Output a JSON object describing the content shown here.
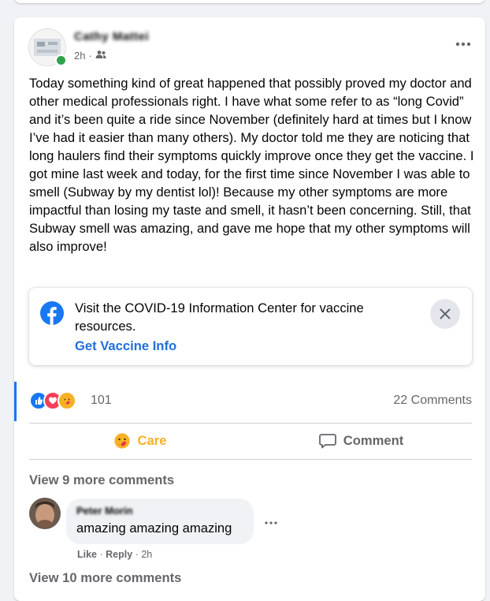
{
  "post": {
    "author": "Cathy Mattei",
    "time": "2h",
    "audience_icon": "friends-icon",
    "text": "Today something kind of great happened that possibly proved my doctor and other medical professionals right. I have what some refer to as “long Covid” and it’s been quite a ride since November (definitely hard at times but I know I’ve had it easier than many others). My doctor told me they are noticing that long haulers find their symptoms quickly improve once they get the vaccine. I got mine last week and today, for the first time since November I was able to smell (Subway by my dentist lol)! Because my other symptoms are more impactful than losing my taste and smell, it hasn’t been concerning. Still, that Subway smell was amazing, and gave me hope that my other symptoms will also improve!"
  },
  "info_center": {
    "text": "Visit the COVID-19 Information Center for vaccine resources.",
    "link": "Get Vaccine Info"
  },
  "reactions": {
    "count": "101",
    "comments": "22 Comments",
    "types": [
      "like",
      "love",
      "care"
    ]
  },
  "actions": {
    "care": "Care",
    "comment": "Comment"
  },
  "comments": {
    "view_more_top": "View 9 more comments",
    "items": [
      {
        "author": "Peter Morin",
        "text": "amazing amazing amazing",
        "like": "Like",
        "reply": "Reply",
        "time": "2h"
      }
    ],
    "view_more_bottom": "View 10 more comments"
  },
  "colors": {
    "link": "#216fdb",
    "accent": "#1877f2",
    "care": "#f7b125",
    "muted": "#65676b"
  }
}
